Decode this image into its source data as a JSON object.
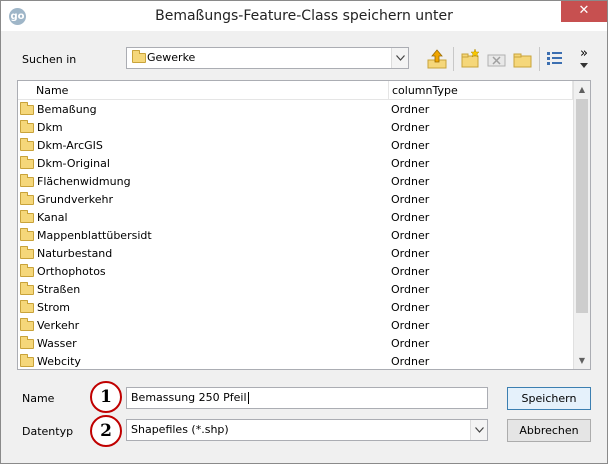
{
  "window": {
    "title": "Bemaßungs-Feature-Class speichern unter",
    "close_glyph": "✕",
    "app_icon": "go-icon"
  },
  "location": {
    "label": "Suchen in",
    "value": "Gewerke",
    "icon": "folder-icon"
  },
  "toolbar": {
    "buttons": [
      "up-one-level-icon",
      "new-folder-icon",
      "delete-icon",
      "connect-folder-icon",
      "view-options-icon",
      "more-icon"
    ],
    "overflow_glyph": "»"
  },
  "list": {
    "columns": [
      "Name",
      "columnType"
    ],
    "rows": [
      {
        "name": "Bemaßung",
        "type": "Ordner"
      },
      {
        "name": "Dkm",
        "type": "Ordner"
      },
      {
        "name": "Dkm-ArcGIS",
        "type": "Ordner"
      },
      {
        "name": "Dkm-Original",
        "type": "Ordner"
      },
      {
        "name": "Flächenwidmung",
        "type": "Ordner"
      },
      {
        "name": "Grundverkehr",
        "type": "Ordner"
      },
      {
        "name": "Kanal",
        "type": "Ordner"
      },
      {
        "name": "Mappenblattübersidt",
        "type": "Ordner"
      },
      {
        "name": "Naturbestand",
        "type": "Ordner"
      },
      {
        "name": "Orthophotos",
        "type": "Ordner"
      },
      {
        "name": "Straßen",
        "type": "Ordner"
      },
      {
        "name": "Strom",
        "type": "Ordner"
      },
      {
        "name": "Verkehr",
        "type": "Ordner"
      },
      {
        "name": "Wasser",
        "type": "Ordner"
      },
      {
        "name": "Webcity",
        "type": "Ordner"
      }
    ]
  },
  "form": {
    "name_label": "Name",
    "name_value": "Bemassung 250 Pfeil",
    "type_label": "Datentyp",
    "type_value": "Shapefiles (*.shp)",
    "save_label": "Speichern",
    "cancel_label": "Abbrechen"
  },
  "annotations": {
    "badge1": "1",
    "badge2": "2",
    "color": "#c00000"
  },
  "colors": {
    "close_button": "#c75050",
    "folder": "#f5d77a",
    "default_button_border": "#3c7fb1"
  }
}
